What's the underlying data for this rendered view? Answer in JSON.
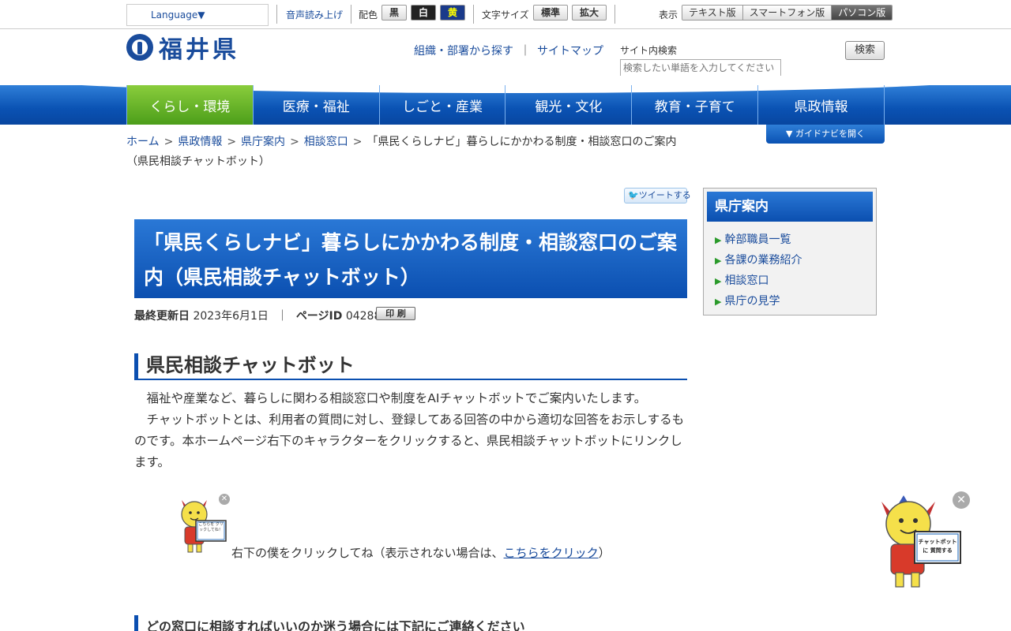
{
  "utility": {
    "language": "Language▼",
    "audio": "音声読み上げ",
    "color_label": "配色",
    "color_black": "黒",
    "color_white": "白",
    "color_yellow": "黄",
    "size_label": "文字サイズ",
    "size_normal": "標準",
    "size_large": "拡大",
    "display_label": "表示",
    "display_text": "テキスト版",
    "display_smart": "スマートフォン版",
    "display_pc": "パソコン版"
  },
  "header": {
    "logo_text": "福井県",
    "link_org": "組織・部署から探す",
    "link_sep": "｜",
    "link_sitemap": "サイトマップ",
    "search_label": "サイト内検索",
    "search_placeholder": "検索したい単語を入力してください",
    "search_button": "検索"
  },
  "nav": {
    "items": [
      "くらし・環境",
      "医療・福祉",
      "しごと・産業",
      "観光・文化",
      "教育・子育て",
      "県政情報"
    ]
  },
  "guide_button": "▼ ガイドナビを開く",
  "breadcrumb": {
    "items": [
      "ホーム",
      "県政情報",
      "県庁案内",
      "相談窓口"
    ],
    "sep": ">",
    "current": "「県民くらしナビ」暮らしにかかわる制度・相談窓口のご案内（県民相談チャットボット）"
  },
  "tweet_label": "ツイートする",
  "page": {
    "title": "「県民くらしナビ」暮らしにかかわる制度・相談窓口のご案内（県民相談チャットボット）",
    "updated_label": "最終更新日",
    "updated_value": "2023年6月1日",
    "meta_sep": "｜",
    "page_id_label": "ページID",
    "page_id_value": "042886",
    "print_label": "印 刷",
    "h2": "県民相談チャットボット",
    "para1": "福祉や産業など、暮らしに関わる相談窓口や制度をAIチャットボットでご案内いたします。",
    "para2": "チャットボットとは、利用者の質問に対し、登録してある回答の中から適切な回答をお示しするものです。本ホームページ右下のキャラクターをクリックすると、県民相談チャットボットにリンクします。",
    "click_prefix": "右下の僕をクリックしてね（表示されない場合は、",
    "click_link": "こちらをクリック",
    "click_suffix": "）",
    "char_sign_small": "こちらを クリックしてね！",
    "h3": "どの窓口に相談すればいいのか迷う場合には下記にご連絡ください"
  },
  "sidebar": {
    "title": "県庁案内",
    "items": [
      "幹部職員一覧",
      "各課の業務紹介",
      "相談窓口",
      "県庁の見学"
    ]
  },
  "chatbot": {
    "sign": "チャットボットに 質問する"
  },
  "colors": {
    "brand_blue": "#0b4fb0",
    "nav_active": "#6cb52a",
    "link": "#1a4c9c"
  }
}
